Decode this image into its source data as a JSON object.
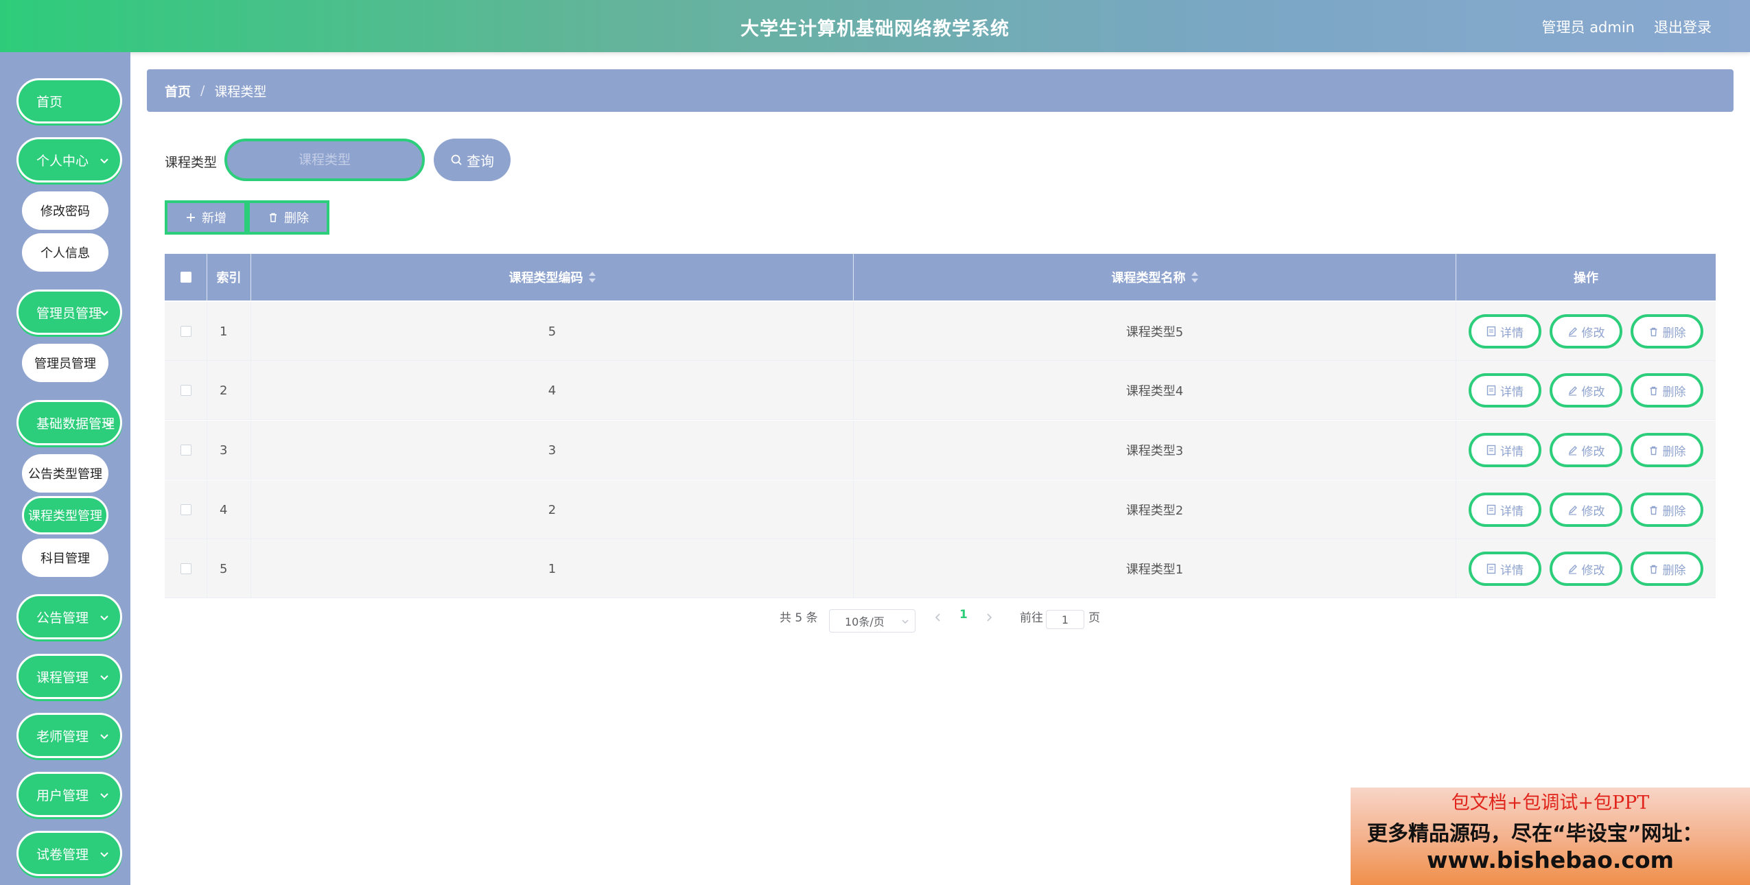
{
  "header": {
    "title": "大学生计算机基础网络教学系统",
    "user": "管理员 admin",
    "logout": "退出登录"
  },
  "sidebar": {
    "home": "首页",
    "personal": "个人中心",
    "change_password": "修改密码",
    "personal_info": "个人信息",
    "admin_mgmt": "管理员管理",
    "admin_sub": "管理员管理",
    "basic_data": "基础数据管理",
    "notice_type": "公告类型管理",
    "course_type": "课程类型管理",
    "subject": "科目管理",
    "notice_mgmt": "公告管理",
    "course_mgmt": "课程管理",
    "teacher_mgmt": "老师管理",
    "user_mgmt": "用户管理",
    "exam_mgmt": "试卷管理"
  },
  "breadcrumb": {
    "home": "首页",
    "sep": "/",
    "current": "课程类型"
  },
  "search": {
    "label": "课程类型",
    "placeholder": "课程类型",
    "button": "查询"
  },
  "actions": {
    "add": "新增",
    "delete": "删除"
  },
  "table": {
    "headers": {
      "index": "索引",
      "code": "课程类型编码",
      "name": "课程类型名称",
      "ops": "操作"
    },
    "rows": [
      {
        "index": "1",
        "code": "5",
        "name": "课程类型5"
      },
      {
        "index": "2",
        "code": "4",
        "name": "课程类型4"
      },
      {
        "index": "3",
        "code": "3",
        "name": "课程类型3"
      },
      {
        "index": "4",
        "code": "2",
        "name": "课程类型2"
      },
      {
        "index": "5",
        "code": "1",
        "name": "课程类型1"
      }
    ],
    "op_labels": {
      "detail": "详情",
      "edit": "修改",
      "delete": "删除"
    }
  },
  "pagination": {
    "total": "共 5 条",
    "page_size": "10条/页",
    "current_page": "1",
    "goto_label": "前往",
    "goto_value": "1",
    "page_suffix": "页"
  },
  "ad": {
    "line1": "包文档+包调试+包PPT",
    "line2": "更多精品源码，尽在“毕设宝”网址：",
    "line3": "www.bishebao.com"
  },
  "colors": {
    "accent_green": "#2dce7b",
    "slate_blue": "#8fa3cf"
  }
}
